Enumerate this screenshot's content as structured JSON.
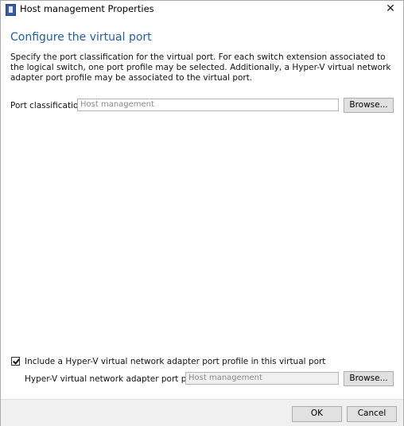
{
  "window": {
    "title": "Host management Properties"
  },
  "page": {
    "heading": "Configure the virtual port",
    "description": "Specify the port classification for the virtual port. For each switch extension associated to the logical switch, one port profile may be selected. Additionally, a Hyper-V virtual network adapter port profile may be associated to the virtual port."
  },
  "port_classification": {
    "label": "Port classification:",
    "value": "Host management",
    "browse_label": "Browse..."
  },
  "hyperv_profile": {
    "checkbox_label": "Include a Hyper-V virtual network adapter port profile in this virtual port",
    "checked": true,
    "label": "Hyper-V virtual network adapter port profile:",
    "value": "Host management",
    "browse_label": "Browse..."
  },
  "footer": {
    "ok_label": "OK",
    "cancel_label": "Cancel"
  },
  "icons": {
    "app": "properties-window-icon",
    "close": "close-icon"
  }
}
